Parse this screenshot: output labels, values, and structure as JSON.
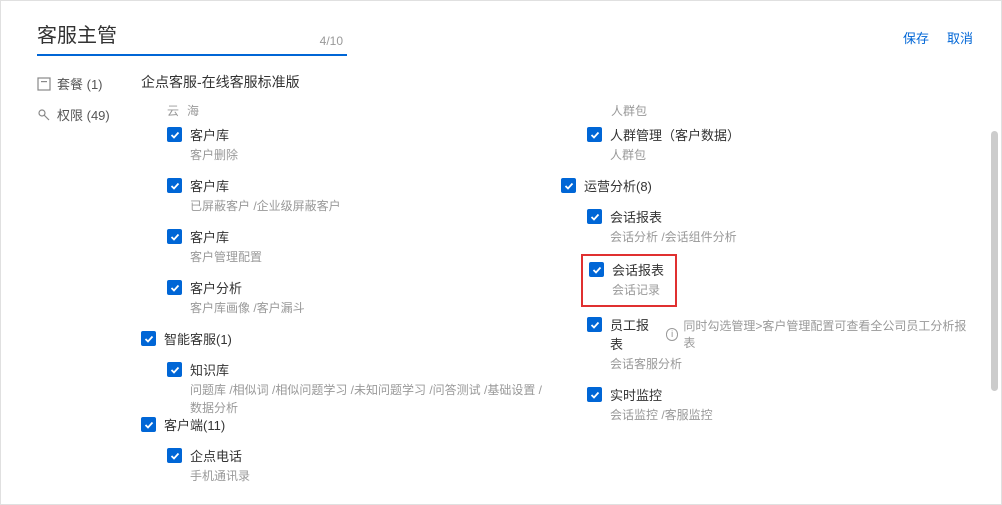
{
  "header": {
    "title": "客服主管",
    "counter": "4/10",
    "save": "保存",
    "cancel": "取消"
  },
  "sidenav": {
    "package_label": "套餐 (1)",
    "permission_label": "权限 (49)"
  },
  "product_title": "企点客服-在线客服标准版",
  "left_cut": "云海",
  "left_items": [
    {
      "label": "客户库",
      "sub": "客户删除"
    },
    {
      "label": "客户库",
      "sub": "已屏蔽客户 /企业级屏蔽客户"
    },
    {
      "label": "客户库",
      "sub": "客户管理配置"
    },
    {
      "label": "客户分析",
      "sub": "客户库画像 /客户漏斗"
    }
  ],
  "left_group_ai": {
    "label": "智能客服(1)"
  },
  "left_group_ai_child": {
    "label": "知识库",
    "sub": "问题库 /相似词 /相似问题学习 /未知问题学习 /问答测试 /基础设置 /数据分析"
  },
  "left_group_client": {
    "label": "客户端(11)"
  },
  "left_group_client_child": {
    "label": "企点电话",
    "sub": "手机通讯录"
  },
  "right_cut": {
    "label_fragment": "人群包"
  },
  "right_items_top": [
    {
      "label": "人群管理（客户数据）",
      "sub": "人群包"
    }
  ],
  "right_group_ops": {
    "label": "运营分析(8)"
  },
  "right_ops_children": [
    {
      "label": "会话报表",
      "sub": "会话分析 /会话组件分析"
    },
    {
      "label": "会话报表",
      "sub": "会话记录",
      "highlighted": true
    },
    {
      "label": "员工报表",
      "info": "同时勾选管理>客户管理配置可查看全公司员工分析报表",
      "sub": "会话客服分析"
    },
    {
      "label": "实时监控",
      "sub": "会话监控 /客服监控"
    }
  ]
}
